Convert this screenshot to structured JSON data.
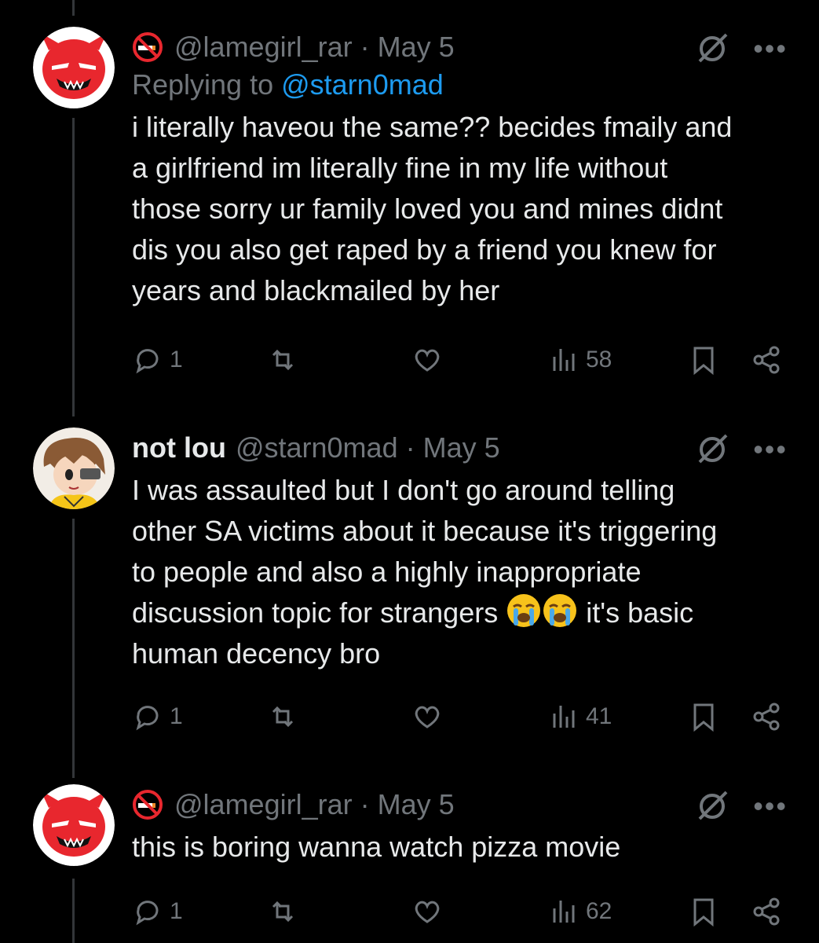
{
  "tweets": [
    {
      "name": "",
      "handle": "@lamegirl_rar",
      "date": "May 5",
      "reply_to": "@starn0mad",
      "replying_prefix": "Replying to ",
      "text_lines": [
        "i literally haveou the same?? becides fmaily and",
        "a girlfriend im literally fine in my life without",
        "those sorry ur family loved you and mines didnt",
        "dis you also get raped by a friend you knew for",
        "years and blackmailed by her"
      ],
      "replies": "1",
      "views": "58",
      "avatar": "red-devil-avatar",
      "name_icon": "no-smoking-icon"
    },
    {
      "name": "not lou",
      "handle": "@starn0mad",
      "date": "May 5",
      "text_lines": [
        "I was assaulted but I don't go around telling",
        "other SA victims about it because it's triggering",
        "to people and also a highly inappropriate",
        "discussion topic for strangers",
        "human decency bro"
      ],
      "line4_suffix": " it's basic",
      "emoji": "loudly-crying-face",
      "replies": "1",
      "views": "41",
      "avatar": "anime-character-avatar"
    },
    {
      "name": "",
      "handle": "@lamegirl_rar",
      "date": "May 5",
      "text_lines": [
        "this is boring wanna watch pizza movie"
      ],
      "replies": "1",
      "views": "62",
      "avatar": "red-devil-avatar",
      "name_icon": "no-smoking-icon"
    }
  ],
  "separator": "·",
  "more_label": "•••",
  "colors": {
    "background": "#000000",
    "text": "#e7e9ea",
    "muted": "#71767b",
    "link": "#1d9bf0",
    "thread_line": "#333639",
    "avatar_red": "#e8272e"
  }
}
